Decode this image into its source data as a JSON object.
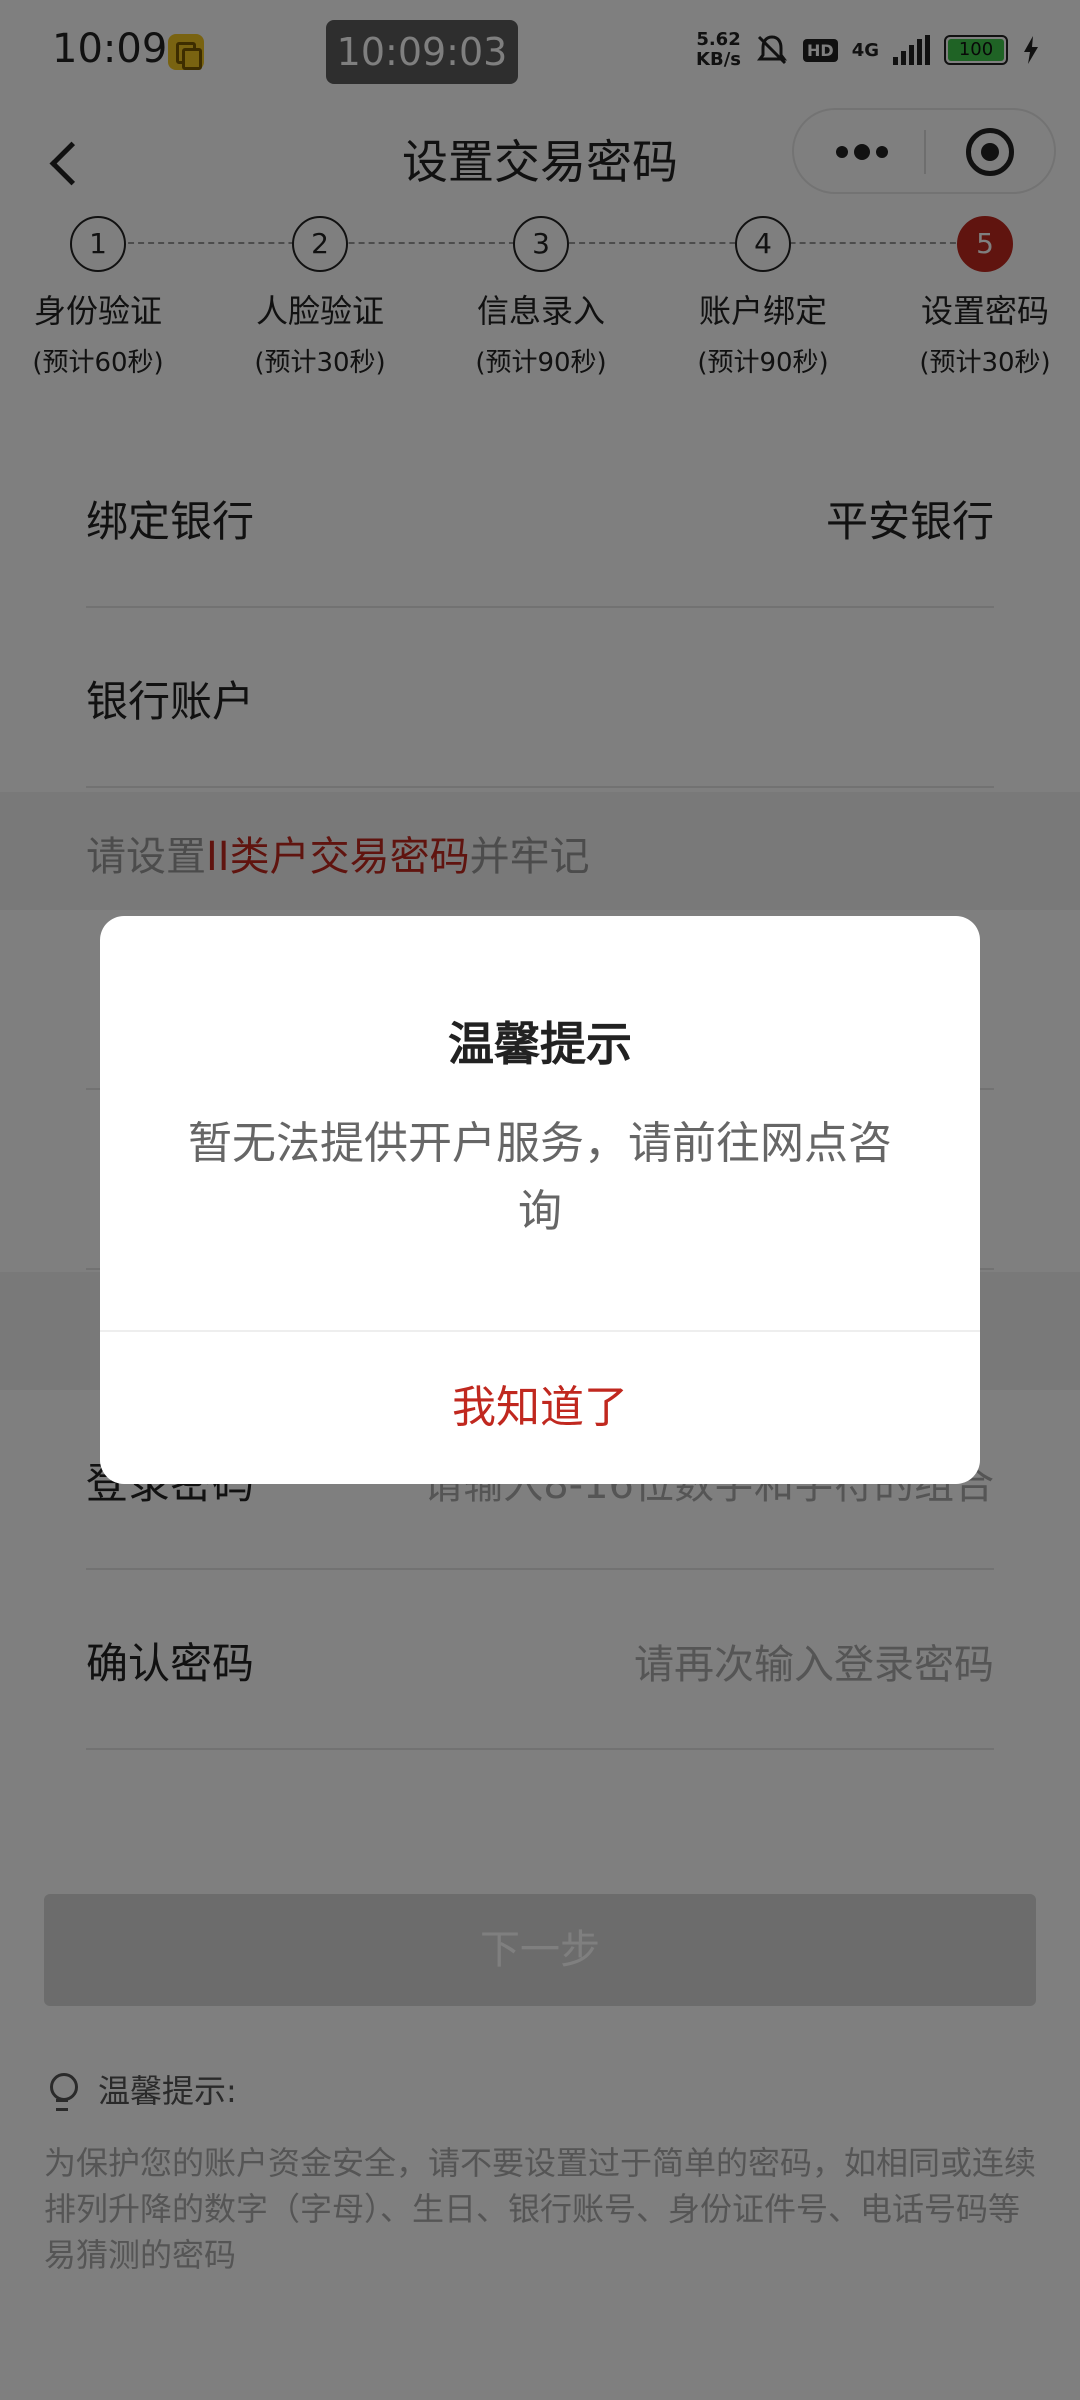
{
  "status_bar": {
    "time": "10:09",
    "clock": "10:09:03",
    "speed_value": "5.62",
    "speed_unit": "KB/s",
    "hd_badge": "HD",
    "network": "4G",
    "battery": "100"
  },
  "nav": {
    "title": "设置交易密码"
  },
  "steps": [
    {
      "number": "1",
      "label": "身份验证",
      "sub": "(预计60秒)"
    },
    {
      "number": "2",
      "label": "人脸验证",
      "sub": "(预计30秒)"
    },
    {
      "number": "3",
      "label": "信息录入",
      "sub": "(预计90秒)"
    },
    {
      "number": "4",
      "label": "账户绑定",
      "sub": "(预计90秒)"
    },
    {
      "number": "5",
      "label": "设置密码",
      "sub": "(预计30秒)"
    }
  ],
  "form": {
    "bank_label": "绑定银行",
    "bank_value": "平安银行",
    "account_label": "银行账户",
    "tip_prefix": "请设置",
    "tip_red": "II类户交易密码",
    "tip_suffix": "并牢记",
    "login_pwd_label": "登录密码",
    "login_pwd_placeholder": "请输入8-16位数字和字符的组合",
    "confirm_pwd_label": "确认密码",
    "confirm_pwd_placeholder": "请再次输入登录密码"
  },
  "next_button": "下一步",
  "hint": {
    "title": "温馨提示:",
    "body": "为保护您的账户资金安全，请不要设置过于简单的密码，如相同或连续排列升降的数字（字母）、生日、银行账号、身份证件号、电话号码等易猜测的密码"
  },
  "dialog": {
    "title": "温馨提示",
    "message": "暂无法提供开户服务，请前往网点咨询",
    "button": "我知道了"
  },
  "colors": {
    "accent": "#c0281f",
    "mask": "rgba(0,0,0,0.5)"
  }
}
